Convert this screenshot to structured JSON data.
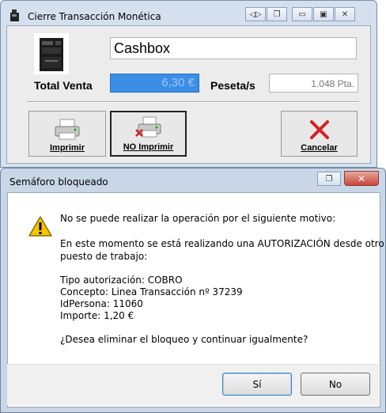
{
  "window_main": {
    "title": "Cierre Transacción Monética",
    "device_name": "Cashbox",
    "total_label": "Total Venta",
    "total_value": "6,30 €",
    "peseta_label": "Peseta/s",
    "peseta_value": "1.048 Pta.",
    "buttons": {
      "print": "Imprimir",
      "no_print": "NO Imprimir",
      "cancel": "Cancelar"
    }
  },
  "dialog": {
    "title": "Semáforo bloqueado",
    "close_glyph": "✕",
    "lines": [
      "No se puede realizar la operación por el siguiente motivo:",
      "En este momento se está realizando una AUTORIZACIÓN desde otro",
      "puesto de trabajo:",
      "Tipo autorización: COBRO",
      "Concepto: Linea Transacción nº 37239",
      "IdPersona: 11060",
      "Importe: 1,20 €",
      "¿Desea eliminar el bloqueo y continuar igualmente?"
    ],
    "yes_label": "Sí",
    "no_label": "No"
  },
  "colors": {
    "total_bg": "#3a8ee6",
    "cancel_x": "#d42020",
    "warn_yellow": "#f5c400"
  },
  "icons": [
    "app-icon",
    "restore-icon",
    "minimize-icon",
    "maximize-icon",
    "close-icon",
    "cash-register-icon",
    "printer-icon",
    "printer-no-icon",
    "cancel-x-icon",
    "warning-icon"
  ]
}
